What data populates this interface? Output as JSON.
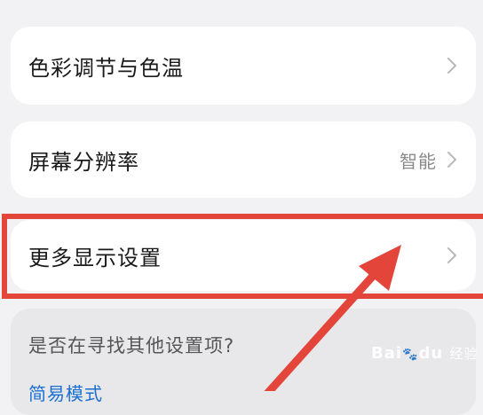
{
  "settings": {
    "items": [
      {
        "label": "色彩调节与色温",
        "value": ""
      },
      {
        "label": "屏幕分辨率",
        "value": "智能"
      },
      {
        "label": "更多显示设置",
        "value": ""
      }
    ],
    "suggestion": {
      "question": "是否在寻找其他设置项?",
      "link": "简易模式"
    }
  },
  "watermark": {
    "brand": "Bai",
    "brand2": "du",
    "suffix": "经验"
  },
  "colors": {
    "highlight": "#e4453a",
    "link": "#1a6fd1",
    "background": "#f2f2f4"
  }
}
